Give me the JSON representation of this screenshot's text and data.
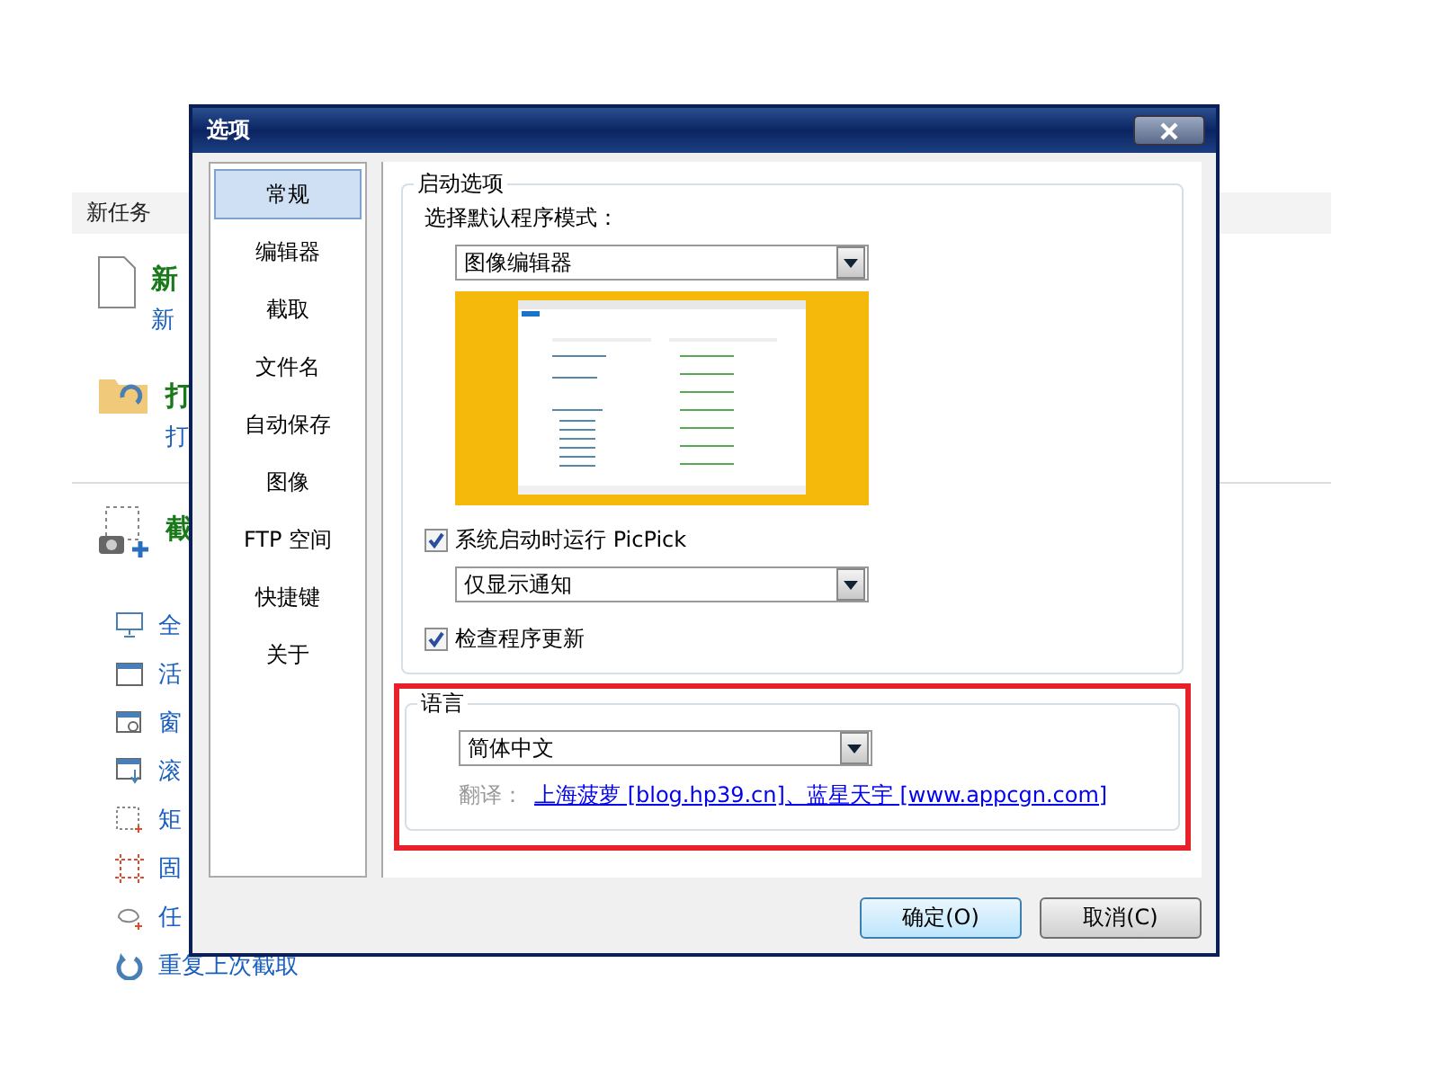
{
  "background_app": {
    "section_title": "新任务",
    "tasks": [
      {
        "kind": "file",
        "title": "新",
        "subtitle": "新"
      },
      {
        "kind": "folder",
        "title": "打",
        "subtitle": "打"
      }
    ],
    "capture": {
      "title": "截",
      "items": [
        {
          "kind": "monitor",
          "label": "全"
        },
        {
          "kind": "window",
          "label": "活"
        },
        {
          "kind": "search-window",
          "label": "窗"
        },
        {
          "kind": "scroll",
          "label": "滚"
        },
        {
          "kind": "region",
          "label": "矩"
        },
        {
          "kind": "fixed",
          "label": "固"
        },
        {
          "kind": "freehand",
          "label": "任"
        },
        {
          "kind": "repeat",
          "label": "重复上次截取"
        }
      ]
    }
  },
  "dialog": {
    "title": "选项",
    "nav": [
      {
        "label": "常规",
        "selected": true
      },
      {
        "label": "编辑器",
        "selected": false
      },
      {
        "label": "截取",
        "selected": false
      },
      {
        "label": "文件名",
        "selected": false
      },
      {
        "label": "自动保存",
        "selected": false
      },
      {
        "label": "图像",
        "selected": false
      },
      {
        "label": "FTP 空间",
        "selected": false
      },
      {
        "label": "快捷键",
        "selected": false
      },
      {
        "label": "关于",
        "selected": false
      }
    ],
    "startup": {
      "title": "启动选项",
      "mode_label": "选择默认程序模式：",
      "mode_value": "图像编辑器",
      "options": [
        {
          "label": "系统启动时运行 PicPick",
          "checked": true,
          "dropdown": "仅显示通知"
        },
        {
          "label": "检查程序更新",
          "checked": true
        }
      ]
    },
    "language": {
      "title": "语言",
      "value": "简体中文",
      "credit_label": "翻译：",
      "credit_link": "上海菠萝 [blog.hp39.cn]、蓝星天宇 [www.appcgn.com]",
      "highlighted": true
    },
    "buttons": [
      {
        "label": "确定(O)",
        "default": true
      },
      {
        "label": "取消(C)",
        "default": false
      }
    ]
  }
}
